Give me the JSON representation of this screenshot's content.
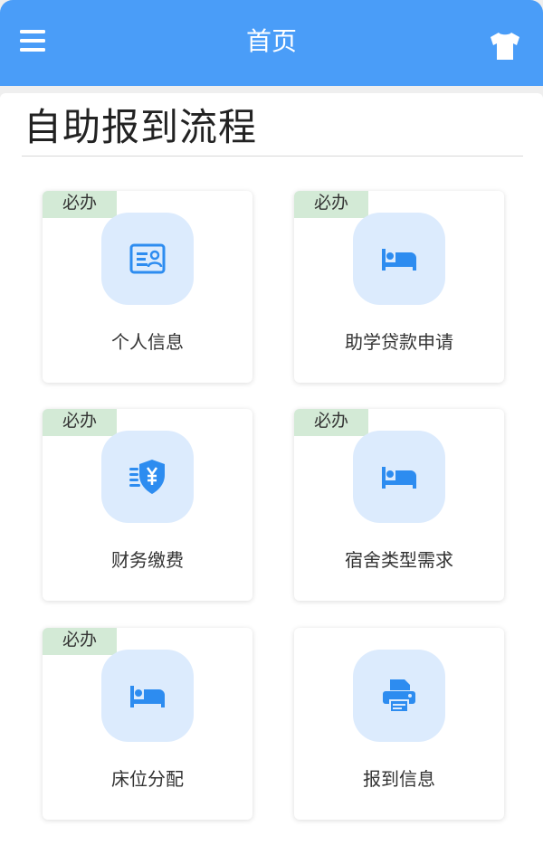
{
  "header": {
    "title": "首页",
    "menu_icon": "hamburger-menu-icon",
    "right_icon": "tshirt-icon",
    "background_color": "#4a9df8"
  },
  "section": {
    "title": "自助报到流程"
  },
  "cards": [
    {
      "label": "个人信息",
      "badge": "必办",
      "icon": "id-card-icon"
    },
    {
      "label": "助学贷款申请",
      "badge": "必办",
      "icon": "bed-icon"
    },
    {
      "label": "财务缴费",
      "badge": "必办",
      "icon": "yuan-shield-icon"
    },
    {
      "label": "宿舍类型需求",
      "badge": "必办",
      "icon": "bed-icon"
    },
    {
      "label": "床位分配",
      "badge": "必办",
      "icon": "bed-icon"
    },
    {
      "label": "报到信息",
      "badge": "",
      "icon": "printer-icon"
    }
  ],
  "colors": {
    "accent": "#2d8cf0",
    "icon_tile": "#dcebfd",
    "badge": "#d3ead6"
  }
}
